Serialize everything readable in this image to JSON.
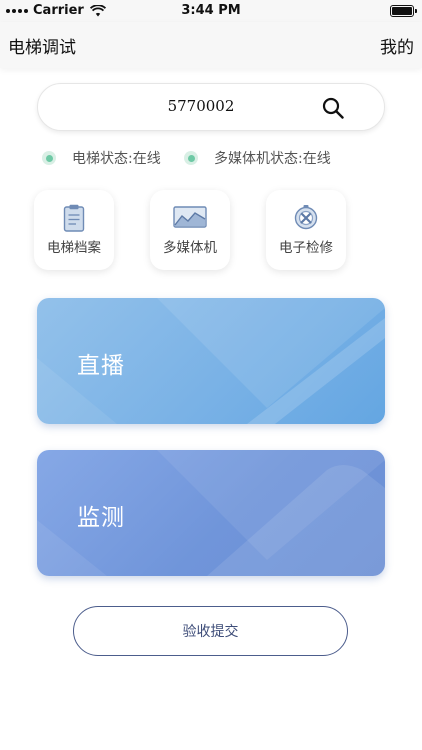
{
  "status_bar": {
    "carrier": "Carrier",
    "time": "3:44 PM",
    "battery_level": 1.0
  },
  "nav": {
    "title": "电梯调试",
    "right_label": "我的"
  },
  "search": {
    "value": "5770002",
    "icon": "search-icon"
  },
  "status": {
    "elevator": "电梯状态:在线",
    "media": "多媒体机状态:在线",
    "online_color": "#6ec9a5"
  },
  "tiles": [
    {
      "label": "电梯档案",
      "icon": "clipboard-icon"
    },
    {
      "label": "多媒体机",
      "icon": "monitor-chart-icon"
    },
    {
      "label": "电子检修",
      "icon": "wrench-badge-icon"
    }
  ],
  "cards": {
    "live": {
      "label": "直播",
      "color": "#7ab2e6"
    },
    "monitor": {
      "label": "监测",
      "color": "#7095da"
    }
  },
  "submit": {
    "label": "验收提交",
    "border_color": "#4c5d8c"
  }
}
